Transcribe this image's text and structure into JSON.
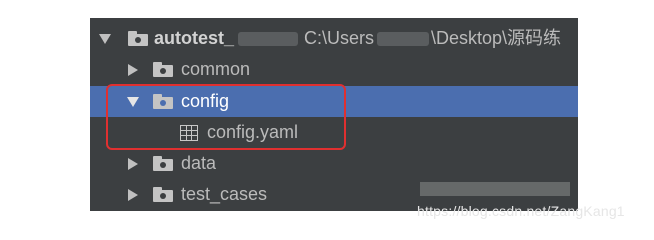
{
  "tree": {
    "root": {
      "name": "autotest_",
      "path_prefix": "C:\\Users",
      "path_suffix": "\\Desktop\\源码练"
    },
    "items": [
      {
        "label": "common"
      },
      {
        "label": "config"
      },
      {
        "label": "config.yaml"
      },
      {
        "label": "data"
      },
      {
        "label": "test_cases"
      }
    ]
  },
  "watermark": {
    "text": "https://blog.csdn.net/ZangKang1"
  },
  "colors": {
    "panel_bg": "#3c3f41",
    "selection": "#4b6eaf",
    "highlight_border": "#e03030"
  },
  "icons": {
    "collapsed": "chevron-right-icon",
    "expanded": "chevron-down-icon",
    "folder": "folder-icon",
    "file": "yaml-file-icon"
  }
}
